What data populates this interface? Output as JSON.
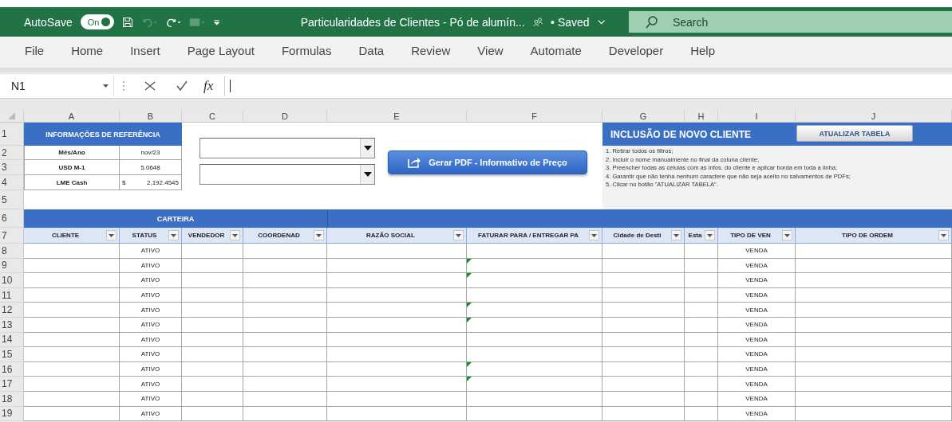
{
  "title_bar": {
    "autosave_label": "AutoSave",
    "autosave_toggle": {
      "label": "On",
      "on": true
    },
    "title": "Particularidades de Clientes - Pó de alumín...",
    "status": "• Saved",
    "search": {
      "placeholder": "Search"
    }
  },
  "ribbon_tabs": [
    {
      "label": "File",
      "selected": false
    },
    {
      "label": "Home",
      "selected": false
    },
    {
      "label": "Insert",
      "selected": false
    },
    {
      "label": "Page Layout",
      "selected": false
    },
    {
      "label": "Formulas",
      "selected": false
    },
    {
      "label": "Data",
      "selected": false
    },
    {
      "label": "Review",
      "selected": false
    },
    {
      "label": "View",
      "selected": false
    },
    {
      "label": "Automate",
      "selected": false
    },
    {
      "label": "Developer",
      "selected": false
    },
    {
      "label": "Help",
      "selected": false
    }
  ],
  "formula_bar": {
    "name_box": "N1",
    "function_label": "fx"
  },
  "sheet": {
    "column_letters": [
      "A",
      "B",
      "C",
      "D",
      "E",
      "F",
      "G",
      "H",
      "I",
      "J"
    ],
    "row_numbers": [
      "1",
      "2",
      "3",
      "4",
      "5",
      "6",
      "7",
      "8",
      "9",
      "10",
      "11",
      "12",
      "13",
      "14",
      "15",
      "16",
      "17",
      "18",
      "19"
    ],
    "reference": {
      "title": "INFORMAÇÕES DE REFERÊNCIA",
      "items": [
        {
          "label": "Mês/Ano",
          "value": "nov/23"
        },
        {
          "label": "USD M-1",
          "value": "5.0648"
        },
        {
          "label": "LME Cash",
          "currency": "$",
          "value": "2,192.4545"
        }
      ]
    },
    "pdf_button": "Gerar PDF - Informativo de Preço",
    "new_client": {
      "title": "INCLUSÃO DE NOVO CLIENTE",
      "button": "ATUALIZAR TABELA",
      "steps": [
        "1. Retirar todos os filtros;",
        "2. Incluir o nome manualmente no final da coluna cliente;",
        "3. Preencher todas as celulas com as infos. do cliente e aplicar borda em toda a linha;",
        "4. Garantir que não tenha nenhum caractere que não seja aceito no salvamentos de PDFs;",
        "5. Clicar no botão \"ATUALIZAR TABELA\"."
      ]
    },
    "section_title": "CARTEIRA",
    "table": {
      "columns": [
        "CLIENTE",
        "STATUS",
        "VENDEDOR",
        "COORDENAD",
        "RAZÃO SOCIAL",
        "FATURAR PARA / ENTREGAR PA",
        "Cidade de Desti",
        "Esta",
        "TIPO DE VEN",
        "TIPO DE ORDEM"
      ],
      "rows": [
        {
          "status": "ATIVO",
          "sale_type": "VENDA",
          "error_mark": false
        },
        {
          "status": "ATIVO",
          "sale_type": "VENDA",
          "error_mark": true
        },
        {
          "status": "ATIVO",
          "sale_type": "VENDA",
          "error_mark": true
        },
        {
          "status": "ATIVO",
          "sale_type": "VENDA",
          "error_mark": false
        },
        {
          "status": "ATIVO",
          "sale_type": "VENDA",
          "error_mark": true
        },
        {
          "status": "ATIVO",
          "sale_type": "VENDA",
          "error_mark": true
        },
        {
          "status": "ATIVO",
          "sale_type": "VENDA",
          "error_mark": false
        },
        {
          "status": "ATIVO",
          "sale_type": "VENDA",
          "error_mark": false
        },
        {
          "status": "ATIVO",
          "sale_type": "VENDA",
          "error_mark": true
        },
        {
          "status": "ATIVO",
          "sale_type": "VENDA",
          "error_mark": true
        },
        {
          "status": "ATIVO",
          "sale_type": "VENDA",
          "error_mark": false
        },
        {
          "status": "ATIVO",
          "sale_type": "VENDA",
          "error_mark": false
        }
      ]
    }
  }
}
